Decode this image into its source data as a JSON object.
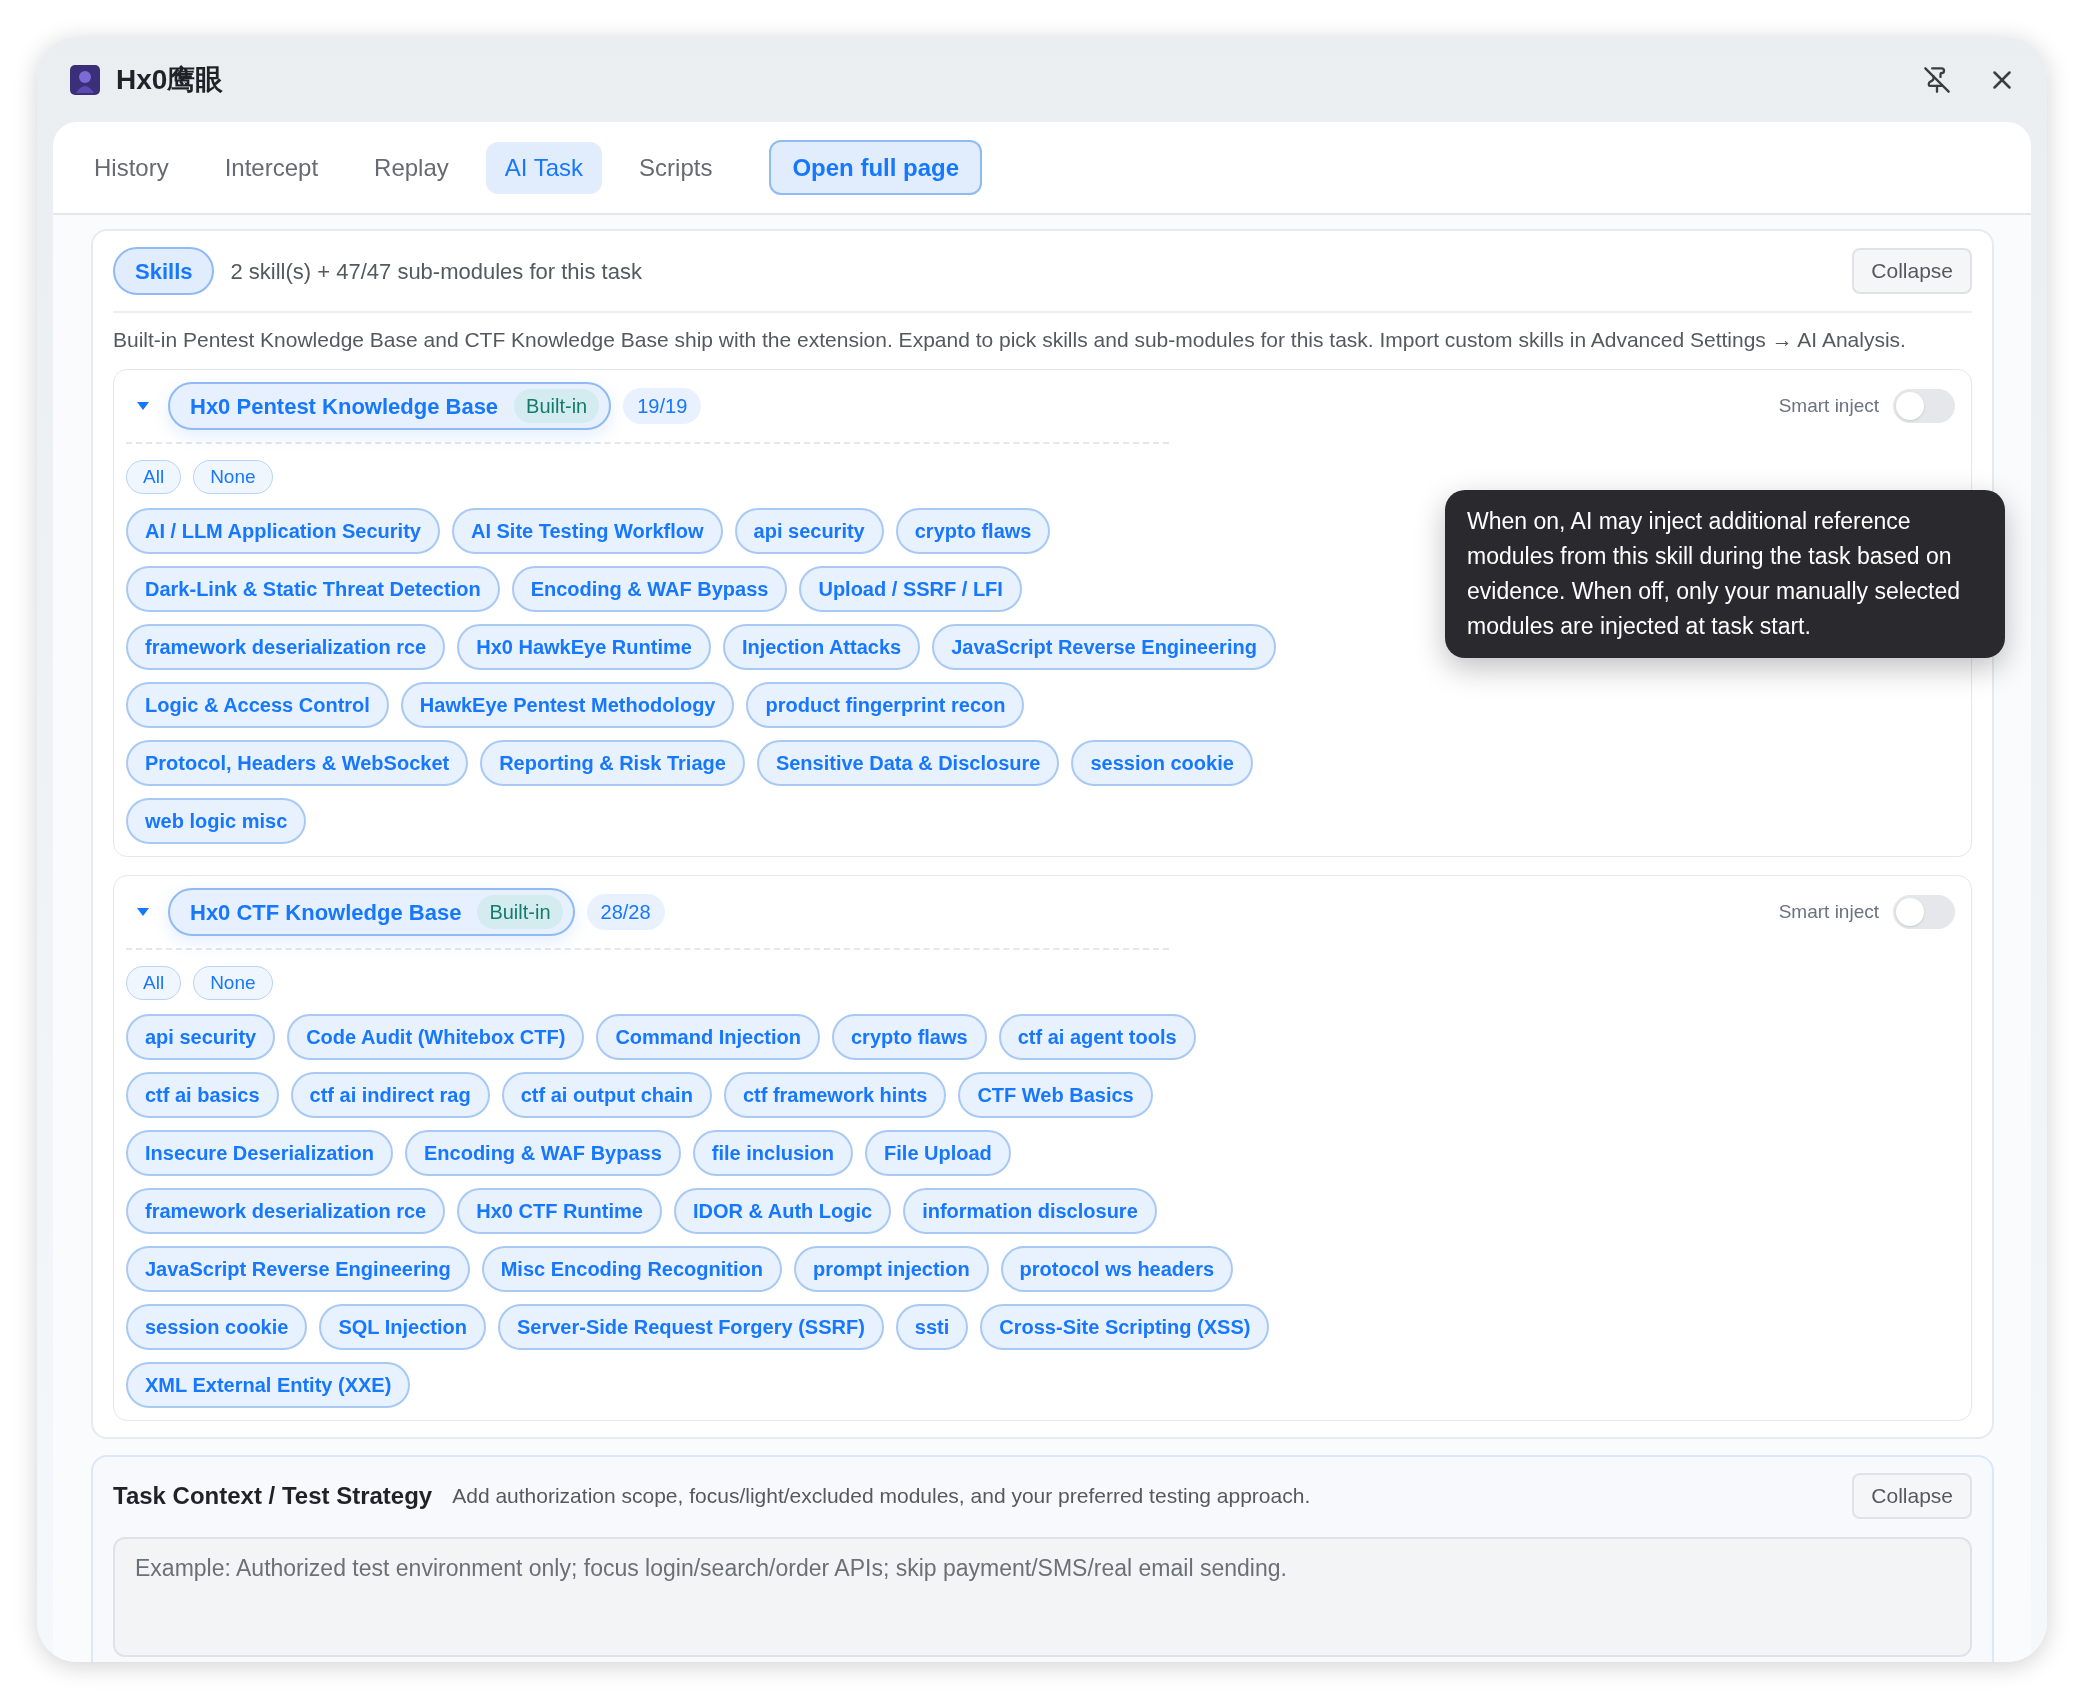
{
  "window": {
    "title": "Hx0鹰眼"
  },
  "tabs": [
    {
      "label": "History",
      "selected": false
    },
    {
      "label": "Intercept",
      "selected": false
    },
    {
      "label": "Replay",
      "selected": false
    },
    {
      "label": "AI Task",
      "selected": true
    },
    {
      "label": "Scripts",
      "selected": false
    }
  ],
  "open_full_page": "Open full page",
  "skills_panel": {
    "label": "Skills",
    "summary": "2 skill(s) + 47/47 sub-modules for this task",
    "collapse": "Collapse",
    "description": "Built-in Pentest Knowledge Base and CTF Knowledge Base ship with the extension. Expand to pick skills and sub-modules for this task. Import custom skills in Advanced Settings → AI Analysis.",
    "skills": [
      {
        "name": "Hx0 Pentest Knowledge Base",
        "selected": true,
        "expanded": true,
        "badge": "Built-in",
        "count": "19/19",
        "smart_inject_label": "Smart inject",
        "smart_inject": false,
        "select_all": "All",
        "select_none": "None",
        "modules": [
          {
            "label": "AI / LLM Application Security",
            "selected": true
          },
          {
            "label": "AI Site Testing Workflow",
            "selected": true
          },
          {
            "label": "api security",
            "selected": true
          },
          {
            "label": "crypto flaws",
            "selected": true
          },
          {
            "label": "Dark-Link & Static Threat Detection",
            "selected": true
          },
          {
            "label": "Encoding & WAF Bypass",
            "selected": true
          },
          {
            "label": "Upload / SSRF / LFI",
            "selected": true
          },
          {
            "label": "framework deserialization rce",
            "selected": true
          },
          {
            "label": "Hx0 HawkEye Runtime",
            "selected": true
          },
          {
            "label": "Injection Attacks",
            "selected": true
          },
          {
            "label": "JavaScript Reverse Engineering",
            "selected": true
          },
          {
            "label": "Logic & Access Control",
            "selected": true
          },
          {
            "label": "HawkEye Pentest Methodology",
            "selected": true
          },
          {
            "label": "product fingerprint recon",
            "selected": true
          },
          {
            "label": "Protocol, Headers & WebSocket",
            "selected": true
          },
          {
            "label": "Reporting & Risk Triage",
            "selected": true
          },
          {
            "label": "Sensitive Data & Disclosure",
            "selected": true
          },
          {
            "label": "session cookie",
            "selected": true
          },
          {
            "label": "web logic misc",
            "selected": true
          }
        ]
      },
      {
        "name": "Hx0 CTF Knowledge Base",
        "selected": true,
        "expanded": true,
        "badge": "Built-in",
        "count": "28/28",
        "smart_inject_label": "Smart inject",
        "smart_inject": false,
        "select_all": "All",
        "select_none": "None",
        "modules": [
          {
            "label": "api security",
            "selected": true
          },
          {
            "label": "Code Audit (Whitebox CTF)",
            "selected": true
          },
          {
            "label": "Command Injection",
            "selected": true
          },
          {
            "label": "crypto flaws",
            "selected": true
          },
          {
            "label": "ctf ai agent tools",
            "selected": true
          },
          {
            "label": "ctf ai basics",
            "selected": true
          },
          {
            "label": "ctf ai indirect rag",
            "selected": true
          },
          {
            "label": "ctf ai output chain",
            "selected": true
          },
          {
            "label": "ctf framework hints",
            "selected": true
          },
          {
            "label": "CTF Web Basics",
            "selected": true
          },
          {
            "label": "Insecure Deserialization",
            "selected": true
          },
          {
            "label": "Encoding & WAF Bypass",
            "selected": true
          },
          {
            "label": "file inclusion",
            "selected": true
          },
          {
            "label": "File Upload",
            "selected": true
          },
          {
            "label": "framework deserialization rce",
            "selected": true
          },
          {
            "label": "Hx0 CTF Runtime",
            "selected": true
          },
          {
            "label": "IDOR & Auth Logic",
            "selected": true
          },
          {
            "label": "information disclosure",
            "selected": true
          },
          {
            "label": "JavaScript Reverse Engineering",
            "selected": true
          },
          {
            "label": "Misc Encoding Recognition",
            "selected": true
          },
          {
            "label": "prompt injection",
            "selected": true
          },
          {
            "label": "protocol ws headers",
            "selected": true
          },
          {
            "label": "session cookie",
            "selected": true
          },
          {
            "label": "SQL Injection",
            "selected": true
          },
          {
            "label": "Server-Side Request Forgery (SSRF)",
            "selected": true
          },
          {
            "label": "ssti",
            "selected": true
          },
          {
            "label": "Cross-Site Scripting (XSS)",
            "selected": true
          },
          {
            "label": "XML External Entity (XXE)",
            "selected": true
          }
        ]
      }
    ]
  },
  "tooltip": "When on, AI may inject additional reference modules from this skill during the task based on evidence. When off, only your manually selected modules are injected at task start.",
  "task_context": {
    "title": "Task Context / Test Strategy",
    "description": "Add authorization scope, focus/light/excluded modules, and your preferred testing approach.",
    "collapse": "Collapse",
    "placeholder": "Example: Authorized test environment only; focus login/search/order APIs; skip payment/SMS/real email sending."
  }
}
